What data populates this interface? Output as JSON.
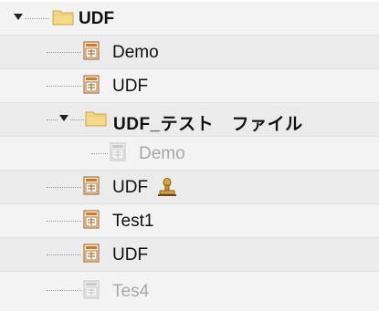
{
  "tree": {
    "root": {
      "label": "UDF",
      "expanded": true,
      "icon": "folder-icon"
    },
    "items": [
      {
        "label": "Demo",
        "icon": "udf-file-icon",
        "disabled": false
      },
      {
        "label": "UDF",
        "icon": "udf-file-icon",
        "disabled": false
      },
      {
        "label": "UDF_テスト　ファイル",
        "icon": "folder-icon",
        "expanded": true,
        "children": [
          {
            "label": "Demo",
            "icon": "udf-file-icon",
            "disabled": true
          }
        ]
      },
      {
        "label": "UDF",
        "icon": "udf-file-icon",
        "badge_icon": "signer-stamp-icon",
        "disabled": false
      },
      {
        "label": "Test1",
        "icon": "udf-file-icon",
        "disabled": false
      },
      {
        "label": "UDF",
        "icon": "udf-file-icon",
        "disabled": false
      },
      {
        "label": "Tes4",
        "icon": "udf-file-icon",
        "disabled": true
      }
    ]
  },
  "colors": {
    "row_alt": "#ebebeb",
    "row_plain": "#f3f3f3",
    "folder": "#f4d98a",
    "udf_icon": "#c87c2f",
    "disabled_text": "#a8a8a8"
  }
}
